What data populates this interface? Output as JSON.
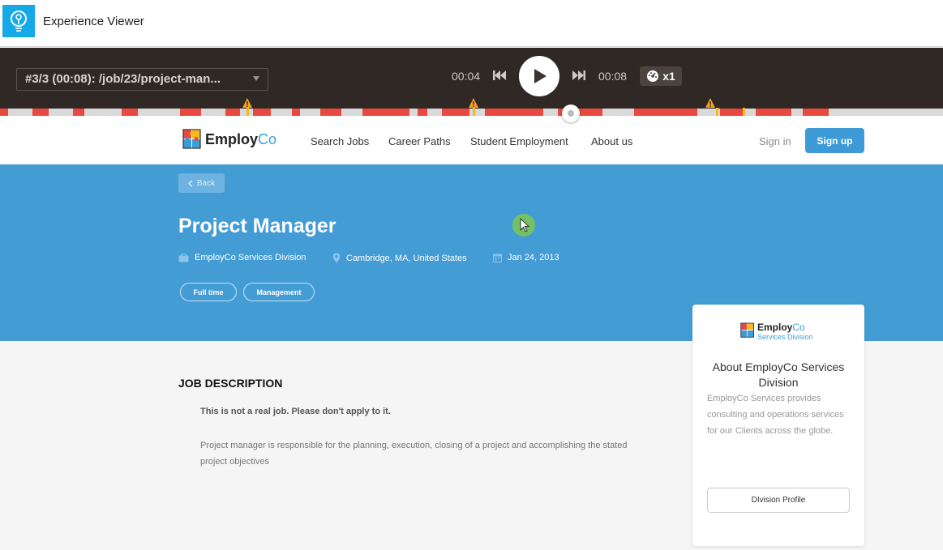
{
  "app": {
    "title": "Experience Viewer"
  },
  "player": {
    "session_label": "#3/3 (00:08): /job/23/project-man...",
    "current_time": "00:04",
    "end_time": "00:08",
    "speed": "x1"
  },
  "site": {
    "brand_first": "Employ",
    "brand_second": "Co",
    "nav": [
      "Search Jobs",
      "Career Paths",
      "Student Employment",
      "About us"
    ],
    "sign_in": "Sign in",
    "sign_up": "Sign up"
  },
  "job": {
    "back_label": "Back",
    "title": "Project Manager",
    "company": "EmployCo Services Division",
    "location": "Cambridge, MA, United States",
    "date": "Jan 24, 2013",
    "tags": [
      "Full time",
      "Management"
    ]
  },
  "description": {
    "heading": "JOB DESCRIPTION",
    "notice": "This is not a real job. Please don't apply to it.",
    "body": "Project manager is responsible for the planning, execution, closing of a project and accomplishing the stated project objectives"
  },
  "division_card": {
    "brand_first": "Employ",
    "brand_second": "Co",
    "brand_sub": "Services Division",
    "title": "About EmployCo Services Division",
    "text": "EmployCo Services provides consulting and operations services for our Clients across the globe.",
    "button": "DIvision Profile"
  },
  "colors": {
    "player_bg": "#2f2825",
    "hero_bg": "#449cd5",
    "accent": "#3d9ad6",
    "timeline_error": "#e8483e",
    "timeline_warning": "#f5b820"
  }
}
